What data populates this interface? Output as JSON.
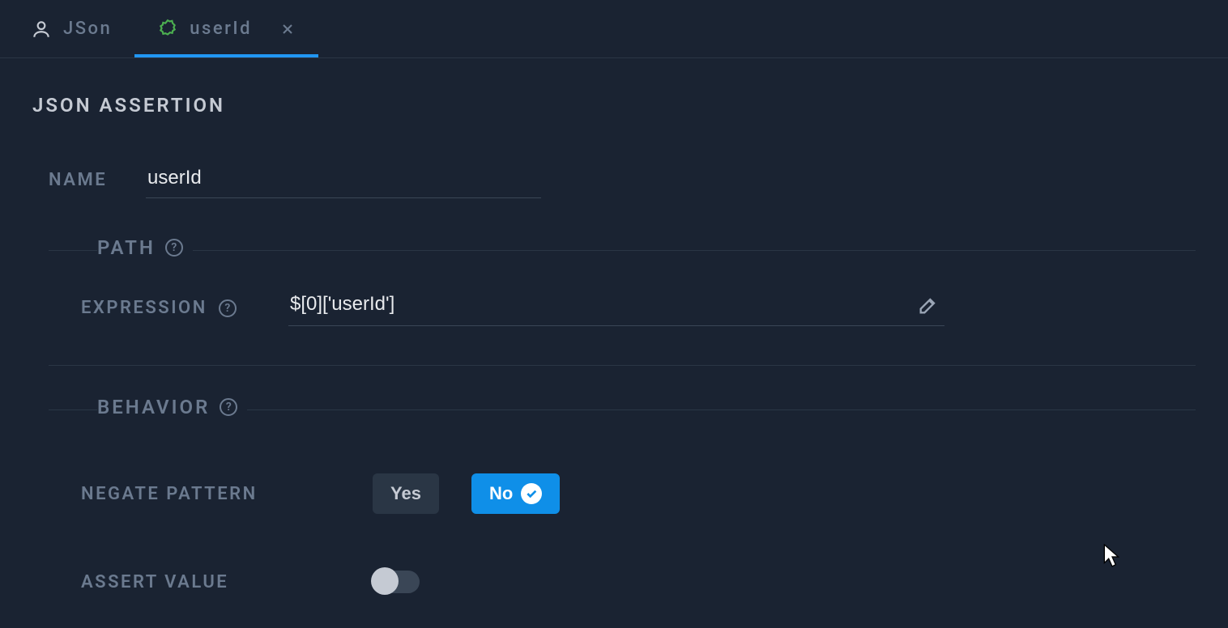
{
  "tabs": [
    {
      "label": "JSon",
      "active": false,
      "closable": false,
      "icon": "user"
    },
    {
      "label": "userId",
      "active": true,
      "closable": true,
      "icon": "badge"
    }
  ],
  "section_title": "JSON ASSERTION",
  "fields": {
    "name_label": "NAME",
    "name_value": "userId"
  },
  "path_group": {
    "legend": "PATH",
    "expression_label": "EXPRESSION",
    "expression_value": "$[0]['userId']"
  },
  "behavior_group": {
    "legend": "BEHAVIOR",
    "negate_label": "NEGATE PATTERN",
    "negate_yes": "Yes",
    "negate_no": "No",
    "negate_selected": "No",
    "assert_value_label": "ASSERT VALUE",
    "assert_value_on": false
  }
}
